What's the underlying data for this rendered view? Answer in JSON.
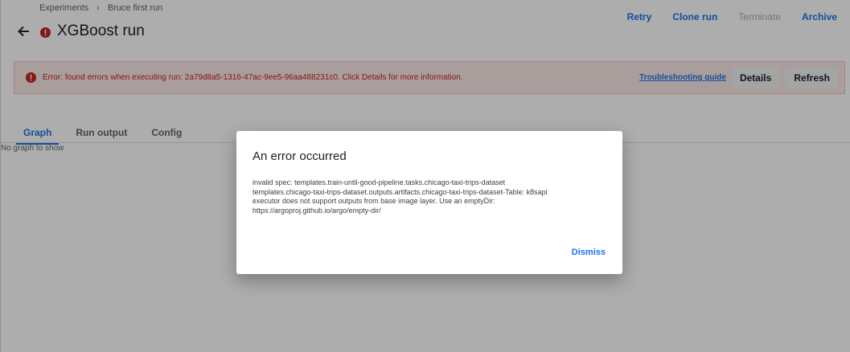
{
  "breadcrumb": {
    "items": [
      "Experiments",
      "Bruce first run"
    ],
    "separator": "›"
  },
  "header": {
    "back_icon": "arrow-back-icon",
    "status_icon": "error-status-icon",
    "title": "XGBoost run",
    "actions": [
      {
        "label": "Retry",
        "enabled": true
      },
      {
        "label": "Clone run",
        "enabled": true
      },
      {
        "label": "Terminate",
        "enabled": false
      },
      {
        "label": "Archive",
        "enabled": true
      }
    ]
  },
  "banner": {
    "icon": "error-icon",
    "message": "Error: found errors when executing run: 2a79d8a5-1316-47ac-9ee5-96aa488231c0. Click Details for more information.",
    "link": "Troubleshooting guide",
    "details_label": "Details",
    "refresh_label": "Refresh"
  },
  "tabs": [
    {
      "label": "Graph",
      "active": true
    },
    {
      "label": "Run output",
      "active": false
    },
    {
      "label": "Config",
      "active": false
    }
  ],
  "graph": {
    "empty_message": "No graph to show"
  },
  "dialog": {
    "title": "An error occurred",
    "body_lines": [
      "invalid spec: templates.train-until-good-pipeline.tasks.chicago-taxi-trips-dataset",
      "templates.chicago-taxi-trips-dataset.outputs.artifacts.chicago-taxi-trips-dataset-Table: k8sapi",
      "executor does not support outputs from base image layer.  Use an emptyDir:",
      "https://argoproj.github.io/argo/empty-dir/"
    ],
    "dismiss_label": "Dismiss"
  },
  "colors": {
    "accent": "#1a73e8",
    "error": "#c5221f",
    "banner_bg": "#fbe9e7",
    "disabled": "#a6acb3"
  }
}
